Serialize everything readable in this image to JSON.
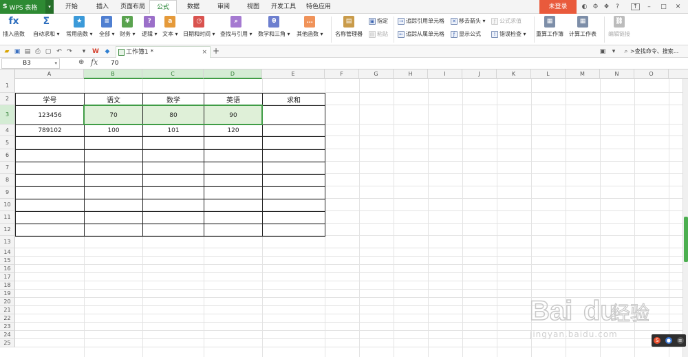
{
  "app": {
    "name": "WPS 表格",
    "logo_glyph": "S"
  },
  "menu_tabs": [
    "开始",
    "插入",
    "页面布局",
    "公式",
    "数据",
    "审阅",
    "视图",
    "开发工具",
    "特色应用"
  ],
  "active_tab": "公式",
  "login_label": "未登录",
  "ribbon": {
    "large": [
      {
        "label": "插入函数",
        "glyph": "fx",
        "color": "#2f6fbe"
      },
      {
        "label": "自动求和 ▾",
        "glyph": "Σ",
        "color": "#2f6fbe"
      },
      {
        "label": "常用函数 ▾",
        "glyph": "★",
        "color": "#3b9ad9"
      },
      {
        "label": "全部 ▾",
        "glyph": "≡",
        "color": "#4f7fd1"
      },
      {
        "label": "财务 ▾",
        "glyph": "¥",
        "color": "#5aa34f"
      },
      {
        "label": "逻辑 ▾",
        "glyph": "?",
        "color": "#9b6fc9"
      },
      {
        "label": "文本 ▾",
        "glyph": "a",
        "color": "#e59a3a"
      },
      {
        "label": "日期和时间 ▾",
        "glyph": "◷",
        "color": "#d9534f"
      },
      {
        "label": "查找与引用 ▾",
        "glyph": "⌕",
        "color": "#a57ad1"
      },
      {
        "label": "数学和三角 ▾",
        "glyph": "θ",
        "color": "#6d7fcf"
      },
      {
        "label": "其他函数 ▾",
        "glyph": "…",
        "color": "#f0935a"
      },
      {
        "label": "名称管理器",
        "glyph": "▤",
        "color": "#c99b4a"
      },
      {
        "label": "重算工作簿",
        "glyph": "▦",
        "color": "#7d8ea8"
      },
      {
        "label": "计算工作表",
        "glyph": "▦",
        "color": "#7d8ea8"
      },
      {
        "label": "编辑链接",
        "glyph": "⛓",
        "color": "#bcbcbc"
      }
    ],
    "small": {
      "define": "指定",
      "paste": "粘贴",
      "trace_precedents": "追踪引用单元格",
      "trace_dependents": "追踪从属单元格",
      "remove_arrows": "移去箭头 ▾",
      "show_formulas": "显示公式",
      "evaluate": "公式求值",
      "error_check": "错误检查 ▾"
    }
  },
  "doc_tab": {
    "title": "工作簿1 *",
    "close": "×",
    "add": "+"
  },
  "command_search": ">查找命令、搜索...",
  "formula_bar": {
    "cell_ref": "B3",
    "fx": "fx",
    "value": "70"
  },
  "columns": [
    "A",
    "B",
    "C",
    "D",
    "E",
    "F",
    "G",
    "H",
    "I",
    "J",
    "K",
    "L",
    "M",
    "N",
    "O"
  ],
  "selected_columns": [
    "B",
    "C",
    "D"
  ],
  "selected_row": 3,
  "row_numbers": [
    1,
    2,
    3,
    4,
    5,
    6,
    7,
    8,
    9,
    10,
    11,
    12,
    13,
    14,
    15,
    16,
    17,
    18,
    19,
    20,
    21,
    22,
    23,
    24,
    25
  ],
  "table": {
    "headers": [
      "学号",
      "语文",
      "数学",
      "英语",
      "求和"
    ],
    "rows": [
      [
        "123456",
        "70",
        "80",
        "90",
        ""
      ],
      [
        "789102",
        "100",
        "101",
        "120",
        ""
      ]
    ],
    "empty_rows": 8
  },
  "watermark": {
    "brand": "Bai",
    "brand2": "du",
    "cn": "经验",
    "url": "jingyan.baidu.com"
  },
  "colors": {
    "accent": "#2e8a33",
    "selection": "#3f9c45",
    "highlight": "#dff0d8",
    "login": "#e95a3c"
  }
}
